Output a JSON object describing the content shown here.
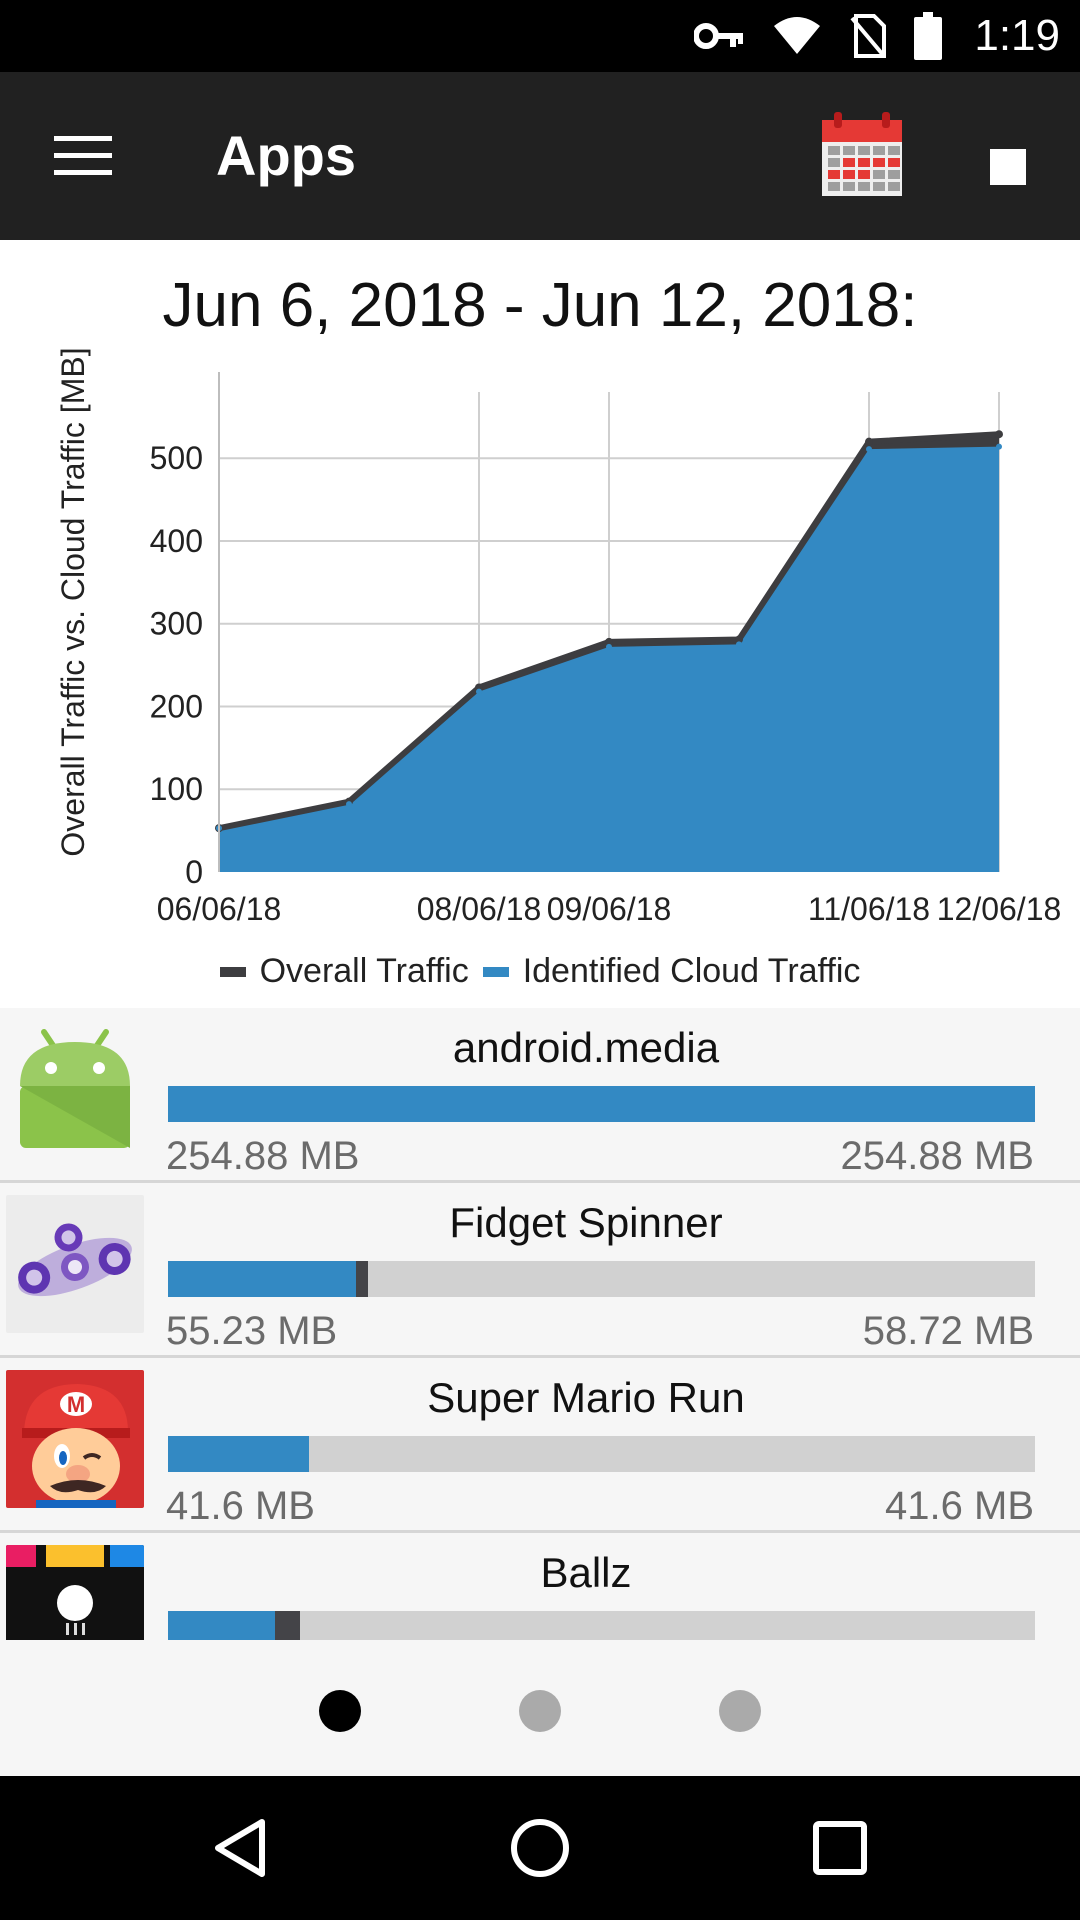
{
  "status_bar": {
    "time": "1:19"
  },
  "app_bar": {
    "title": "Apps",
    "menu_icon": "hamburger-icon",
    "calendar_icon": "calendar-icon",
    "stop_icon": "stop-icon"
  },
  "chart_data": {
    "type": "area",
    "title": "Jun 6, 2018 - Jun 12, 2018:",
    "ylabel": "Overall Traffic vs. Cloud Traffic [MB]",
    "xlabel": "",
    "x": [
      "2018-06-06",
      "2018-06-07",
      "2018-06-08",
      "2018-06-09",
      "2018-06-10",
      "2018-06-11",
      "2018-06-12"
    ],
    "xticks": [
      "06/06/18",
      "08/06/18",
      "09/06/18",
      "11/06/18",
      "12/06/18"
    ],
    "yticks": [
      "0",
      "100",
      "200",
      "300",
      "400",
      "500"
    ],
    "ylim": [
      0,
      580
    ],
    "grid": true,
    "legend_position": "bottom",
    "series": [
      {
        "name": "Overall Traffic",
        "color": "#3d3d40",
        "values": [
          53,
          85,
          223,
          278,
          281,
          520,
          529
        ]
      },
      {
        "name": "Identified Cloud Traffic",
        "color": "#3389c3",
        "values": [
          53,
          82,
          218,
          272,
          275,
          511,
          514
        ]
      }
    ]
  },
  "apps": [
    {
      "name": "android.media",
      "cloud": "254.88 MB",
      "overall": "254.88 MB",
      "cloud_fraction": 1.0,
      "overall_fraction": 1.0,
      "icon": "android-robot-icon"
    },
    {
      "name": "Fidget Spinner",
      "cloud": "55.23 MB",
      "overall": "58.72 MB",
      "cloud_fraction": 0.2167,
      "overall_fraction": 0.2304,
      "icon": "fidget-spinner-icon"
    },
    {
      "name": "Super Mario Run",
      "cloud": "41.6 MB",
      "overall": "41.6 MB",
      "cloud_fraction": 0.1632,
      "overall_fraction": 0.1632,
      "icon": "mario-icon"
    },
    {
      "name": "Ballz",
      "cloud_fraction": 0.123,
      "overall_fraction": 0.152,
      "icon": "ballz-icon"
    }
  ],
  "pager": {
    "pages": 3,
    "current": 1
  },
  "nav_bar": {
    "back_icon": "back-icon",
    "home_icon": "home-icon",
    "recents_icon": "recents-icon"
  }
}
